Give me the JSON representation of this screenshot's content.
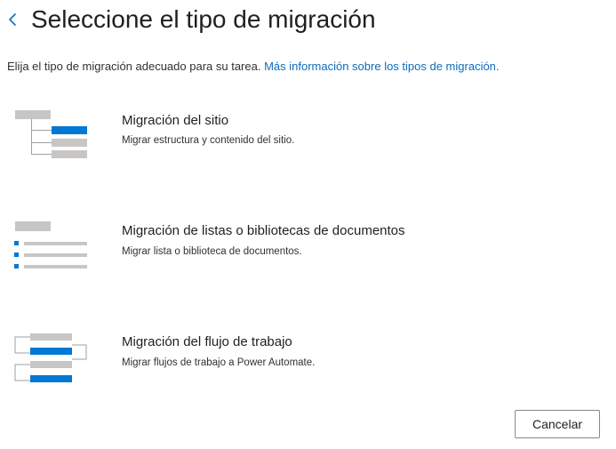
{
  "header": {
    "back_icon": "chevron-left-icon",
    "title": "Seleccione el tipo de migración"
  },
  "intro": {
    "text": "Elija el tipo de migración adecuado para su tarea. ",
    "link": "Más información sobre los tipos de migración."
  },
  "options": [
    {
      "icon": "site-migration-icon",
      "title": "Migración del sitio",
      "description": "Migrar estructura y contenido del sitio."
    },
    {
      "icon": "list-library-migration-icon",
      "title": "Migración de listas o bibliotecas de documentos",
      "description": "Migrar lista o biblioteca de documentos."
    },
    {
      "icon": "workflow-migration-icon",
      "title": "Migración del flujo de trabajo",
      "description": "Migrar flujos de trabajo a Power Automate."
    }
  ],
  "footer": {
    "cancel_label": "Cancelar"
  },
  "colors": {
    "accent": "#0f6cbd",
    "illustration_blue": "#0078d4",
    "illustration_gray": "#c8c6c4",
    "connector_gray": "#a19f9d"
  }
}
